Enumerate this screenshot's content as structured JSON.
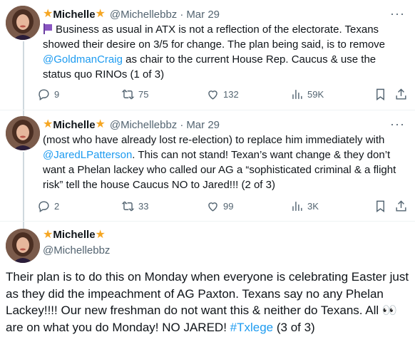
{
  "tweets": [
    {
      "star_left": "★",
      "name": "Michelle",
      "star_right": "★",
      "handle": "@Michellebbz",
      "separator": "·",
      "date": "Mar 29",
      "more": "···",
      "text_1": "Business as usual in ATX is not a reflection of the electorate. Texans showed their desire on 3/5 for change. The plan being said, is to remove ",
      "mention": "@GoldmanCraig",
      "text_2": " as chair to the current House Rep. Caucus & use the status quo RINOs (1 of 3)",
      "replies": "9",
      "reposts": "75",
      "likes": "132",
      "views": "59K"
    },
    {
      "star_left": "★",
      "name": "Michelle",
      "star_right": "★",
      "handle": "@Michellebbz",
      "separator": "·",
      "date": "Mar 29",
      "more": "···",
      "text_1": "(most who have already lost re-election) to replace him immediately with ",
      "mention": "@JaredLPatterson",
      "text_2": ". This can not stand! Texan’s want change & they don’t want a Phelan lackey who called our AG a “sophisticated criminal & a flight risk” tell the house Caucus NO to Jared!!! (2 of 3)",
      "replies": "2",
      "reposts": "33",
      "likes": "99",
      "views": "3K"
    },
    {
      "star_left": "★",
      "name": "Michelle",
      "star_right": "★",
      "handle": "@Michellebbz",
      "text_1": "Their plan is to do this on Monday when everyone is celebrating Easter just as they did the impeachment of AG Paxton. Texans say no any Phelan Lackey!!!! Our new freshman do not want this & neither do Texans. All ",
      "eyes": "👀",
      "text_2": " are on what you do Monday! NO JARED! ",
      "hashtag": "#Txlege",
      "text_3": " (3 of 3)"
    }
  ],
  "icons": {
    "reply": "reply-icon",
    "repost": "repost-icon",
    "like": "heart-icon",
    "views": "views-icon",
    "bookmark": "bookmark-icon",
    "share": "share-icon"
  },
  "colors": {
    "link": "#1d9bf0",
    "muted": "#536471",
    "text": "#0f1419",
    "star": "#f5a623"
  }
}
